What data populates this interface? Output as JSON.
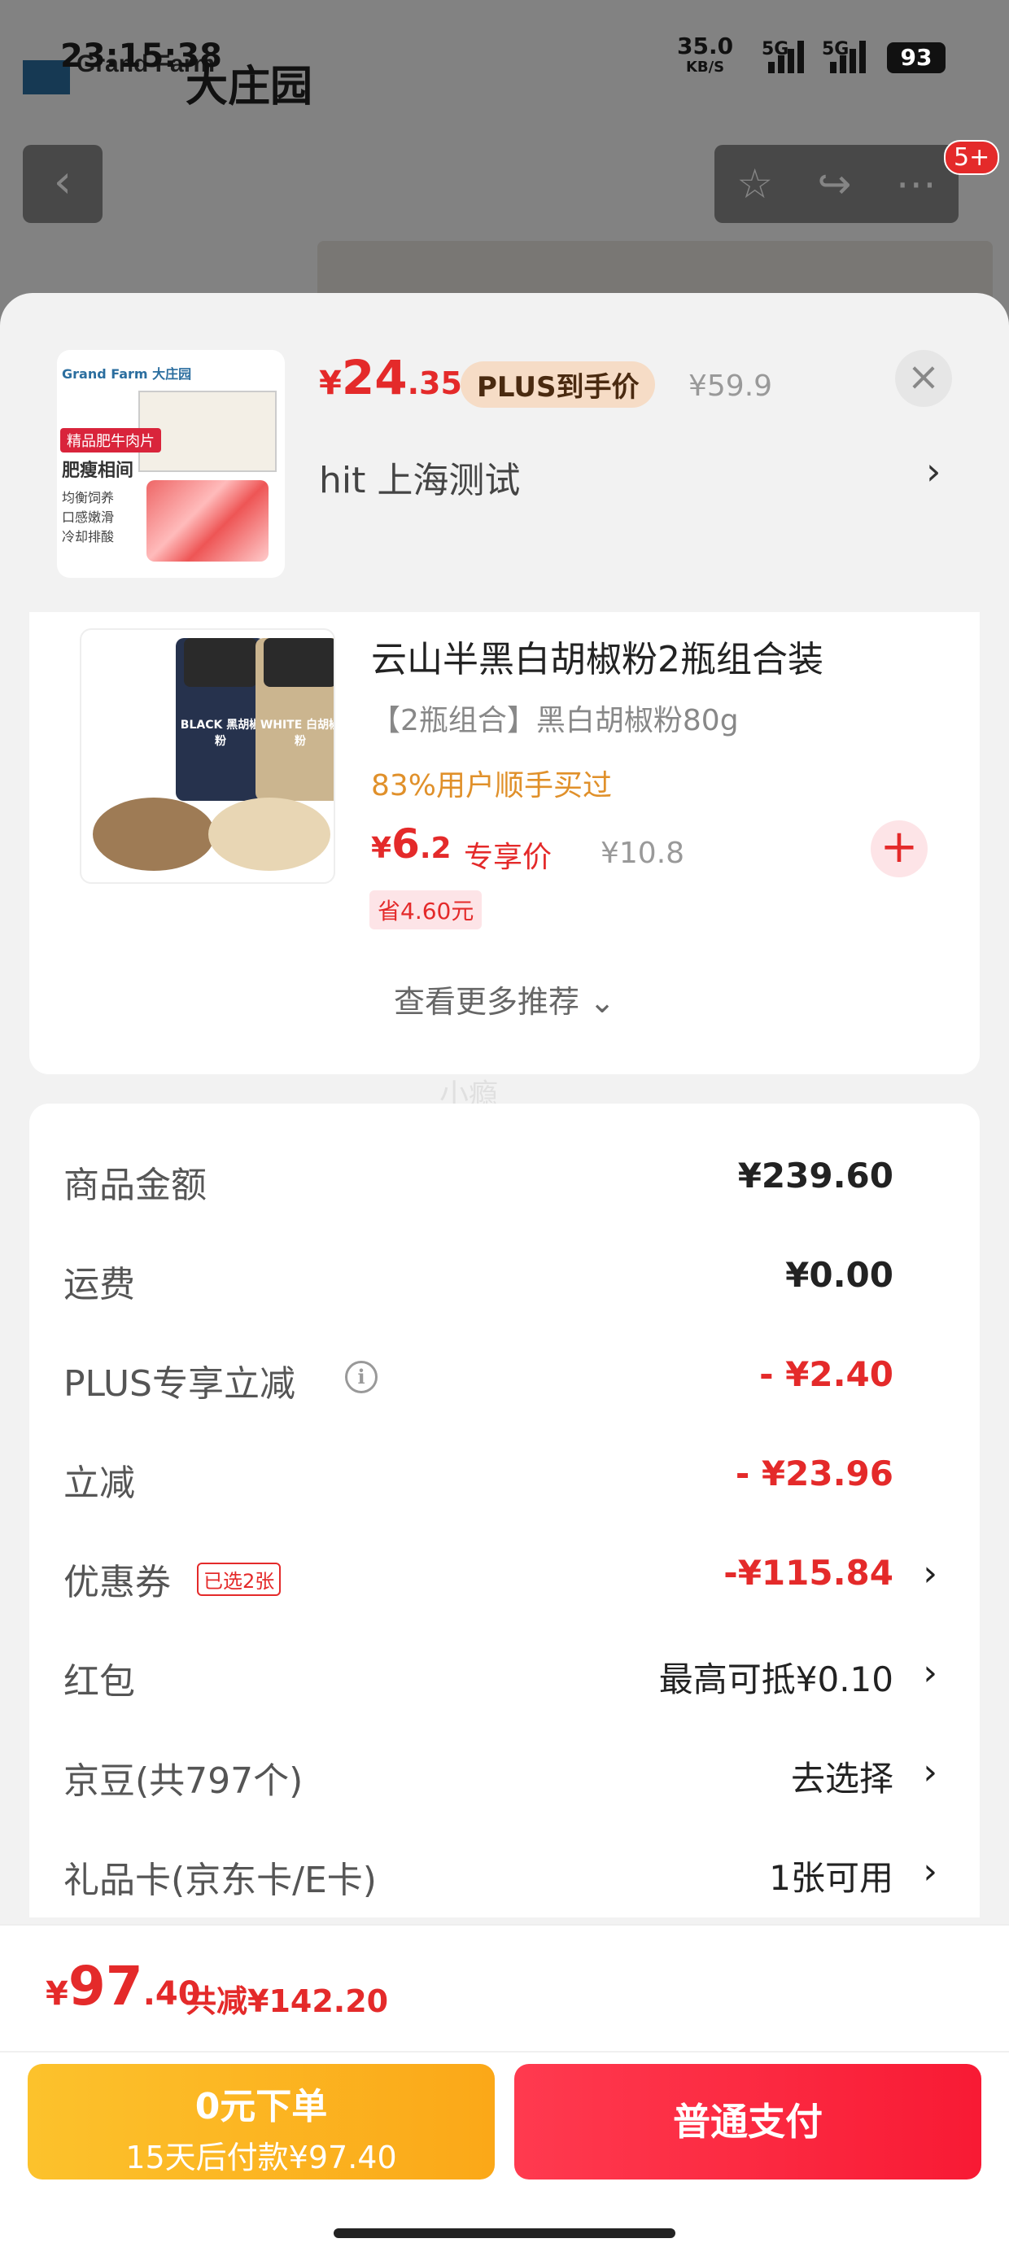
{
  "status_bar": {
    "time": "23:15:38",
    "net_speed": "35.0",
    "net_speed_unit": "KB/S",
    "net1": "5G",
    "net2": "5G",
    "battery": "93"
  },
  "background_page": {
    "brand_en": "Grand Farm",
    "brand_cn": "大庄园",
    "back_icon": "‹",
    "badge": "5+"
  },
  "product": {
    "price_currency": "¥",
    "price_int": "24",
    "price_dec": ".35",
    "plus_tag": "PLUS到手价",
    "original_price": "¥59.9",
    "address": "hit  上海测试",
    "image": {
      "logo": "Grand Farm 大庄园",
      "tag": "精品肥牛肉片",
      "title": "肥瘦相间",
      "features": [
        "均衡饲养",
        "口感嫩滑",
        "冷却排酸"
      ]
    }
  },
  "recommend": {
    "title": "云山半黑白胡椒粉2瓶组合装",
    "subtitle": "【2瓶组合】黑白胡椒粉80g",
    "stat": "83%用户顺手买过",
    "price_currency": "¥",
    "price_int": "6",
    "price_dec": ".2",
    "price_label": "专享价",
    "original_price": "¥10.8",
    "save_tag": "省4.60元",
    "more": "查看更多推荐 ⌄",
    "jar_black": "BLACK 黑胡椒粉",
    "jar_white": "WHITE 白胡椒粉"
  },
  "watermark": "小瘾",
  "details": {
    "rows": [
      {
        "label": "商品金额",
        "value": "¥239.60"
      },
      {
        "label": "运费",
        "value": "¥0.00"
      },
      {
        "label": "PLUS专享立减",
        "value": "- ¥2.40"
      },
      {
        "label": "立减",
        "value": "- ¥23.96"
      },
      {
        "label": "优惠券",
        "tag": "已选2张",
        "value": "-¥115.84"
      },
      {
        "label": "红包",
        "value": "最高可抵¥0.10"
      },
      {
        "label": "京豆(共797个)",
        "value": "去选择"
      },
      {
        "label": "礼品卡(京东卡/E卡)",
        "value": "1张可用"
      }
    ]
  },
  "bottom": {
    "total_currency": "¥",
    "total_int": "97",
    "total_dec": ".40",
    "total_save": "共减¥142.20",
    "btn_zero_line1": "0元下单",
    "btn_zero_line2": "15天后付款¥97.40",
    "btn_pay": "普通支付"
  },
  "colors": {
    "accent_red": "#e42a2a",
    "plus_tag_bg": "#f6dcc6",
    "btn_yellow": "#fcc22c",
    "btn_red": "#f81a34"
  },
  "icons": [
    "back-icon",
    "star-icon",
    "share-icon",
    "more-icon",
    "close-icon",
    "chevron-right-icon",
    "plus-icon",
    "info-icon"
  ]
}
